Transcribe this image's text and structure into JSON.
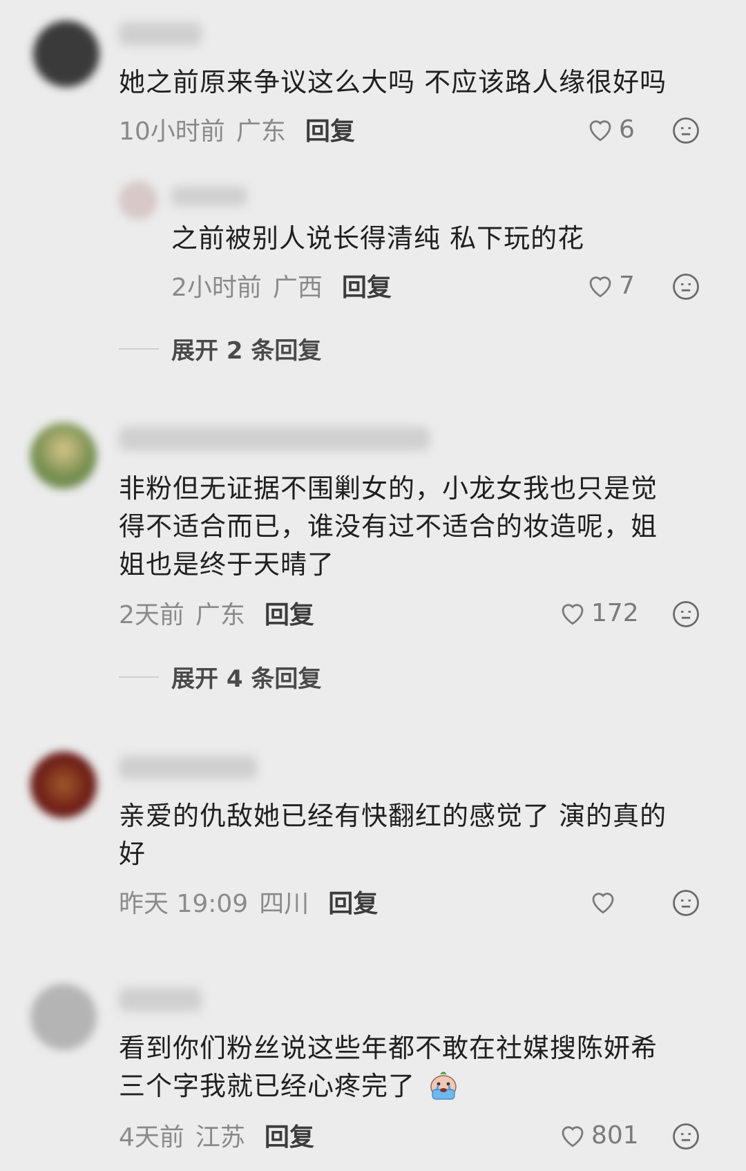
{
  "comments": [
    {
      "text": "她之前原来争议这么大吗 不应该路人缘很好吗",
      "time": "10小时前",
      "location": "广东",
      "reply_label": "回复",
      "likes": "6",
      "avatar_color": "#3a3a3a",
      "replies": [
        {
          "text": "之前被别人说长得清纯 私下玩的花",
          "time": "2小时前",
          "location": "广西",
          "reply_label": "回复",
          "likes": "7",
          "avatar_color": "#d8c8c8"
        }
      ],
      "expand_label": "展开 2 条回复"
    },
    {
      "text_lines": [
        "非粉但无证据不围剿女的，小龙女我也只是觉",
        "得不适合而已，谁没有过不适合的妆造呢，姐",
        "姐也是终于天晴了"
      ],
      "time": "2天前",
      "location": "广东",
      "reply_label": "回复",
      "likes": "172",
      "avatar_color": "#8a9a6a",
      "expand_label": "展开 4 条回复"
    },
    {
      "text_lines": [
        "亲爱的仇敌她已经有快翻红的感觉了 演的真的",
        "好"
      ],
      "time": "昨天 19:09",
      "location": "四川",
      "reply_label": "回复",
      "likes": "",
      "avatar_color": "#7a2a22"
    },
    {
      "text_lines": [
        "看到你们粉丝说这些年都不敢在社媒搜陈妍希",
        "三个字我就已经心疼完了"
      ],
      "time": "4天前",
      "location": "江苏",
      "reply_label": "回复",
      "likes": "801",
      "avatar_color": "#b4b4b4",
      "inline_emoji": "crying-face-emoji"
    }
  ],
  "icons": {
    "like": "heart-outline-icon",
    "emoji": "neutral-face-icon"
  },
  "colors": {
    "background": "#ececec",
    "text": "#1f1f1f",
    "meta": "#8a8a8a"
  }
}
